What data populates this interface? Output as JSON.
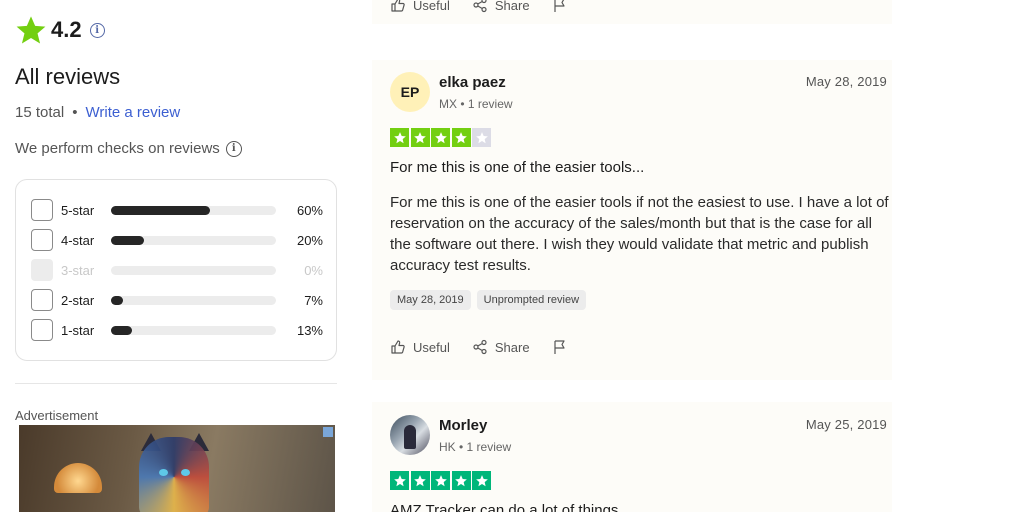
{
  "summary": {
    "rating": "4.2",
    "heading": "All reviews",
    "total": "15 total",
    "write_review": "Write a review",
    "checks": "We perform checks on reviews"
  },
  "distribution": [
    {
      "label": "5-star",
      "percent_text": "60%",
      "percent": 60,
      "enabled": true
    },
    {
      "label": "4-star",
      "percent_text": "20%",
      "percent": 20,
      "enabled": true
    },
    {
      "label": "3-star",
      "percent_text": "0%",
      "percent": 0,
      "enabled": false
    },
    {
      "label": "2-star",
      "percent_text": "7%",
      "percent": 7,
      "enabled": true
    },
    {
      "label": "1-star",
      "percent_text": "13%",
      "percent": 13,
      "enabled": true
    }
  ],
  "advertisement_label": "Advertisement",
  "actions": {
    "useful": "Useful",
    "share": "Share"
  },
  "reviews": [
    {
      "initials": "EP",
      "name": "elka paez",
      "meta": "MX • 1 review",
      "date": "May 28, 2019",
      "stars": 4,
      "title": "For me this is one of the easier tools...",
      "body": "For me this is one of the easier tools if not the easiest to use. I have a lot of reservation on the accuracy of the sales/month but that is the case for all the software out there. I wish they would validate that metric and publish accuracy test results.",
      "tags": [
        "May 28, 2019",
        "Unprompted review"
      ]
    },
    {
      "initials": "",
      "name": "Morley",
      "meta": "HK • 1 review",
      "date": "May 25, 2019",
      "stars": 5,
      "title": "AMZ Tracker can do a lot of things"
    }
  ],
  "colors": {
    "star_green": "#00b67a",
    "star_light_green": "#73cf11",
    "star_empty": "#dcdce6",
    "link_blue": "#3c5fd1"
  }
}
